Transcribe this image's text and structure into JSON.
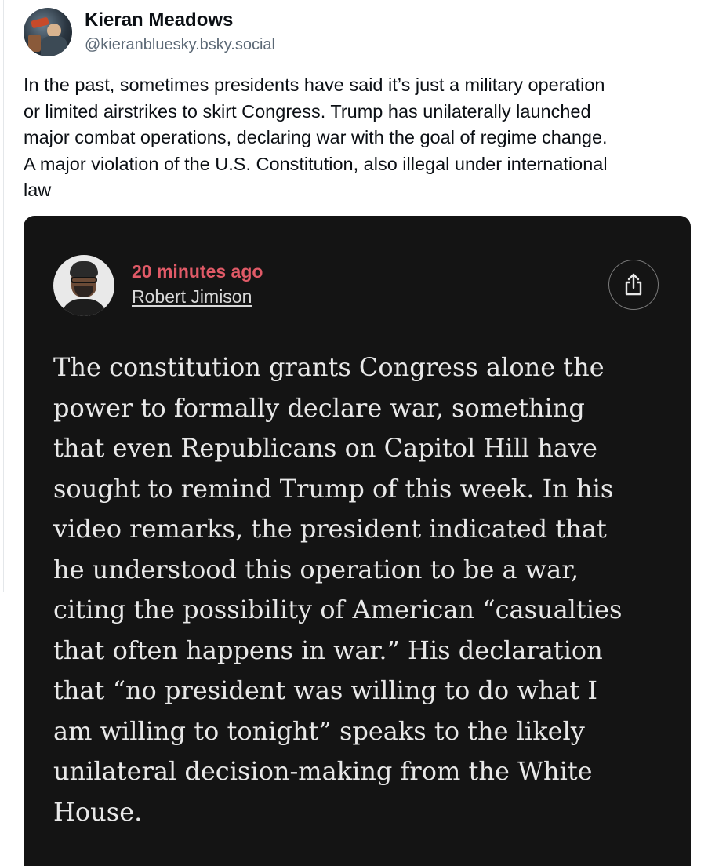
{
  "post": {
    "display_name": "Kieran Meadows",
    "handle": "@kieranbluesky.bsky.social",
    "text": "In the past, sometimes presidents have said it’s just a military operation\nor limited airstrikes to skirt Congress. Trump has unilaterally launched\nmajor combat operations, declaring war with the goal of regime change.\nA major violation of the U.S. Constitution, also illegal under international\nlaw"
  },
  "embed": {
    "time_ago": "20 minutes ago",
    "author": "Robert Jimison",
    "share_icon": "share-icon",
    "quote": "The constitution grants Congress alone the\npower to formally declare war, something\nthat even Republicans on Capitol Hill have\nsought to remind Trump of this week. In his\nvideo remarks, the president indicated that\nhe understood this operation to be a war,\nciting the possibility of American “casualties\nthat often happens in war.” His declaration\nthat “no president was willing to do what I\nam willing to tonight” speaks to the likely\nunilateral decision-making from the White\nHouse."
  },
  "colors": {
    "time_ago": "#e05a67",
    "embed_background": "#141414",
    "handle": "#5b6875"
  }
}
